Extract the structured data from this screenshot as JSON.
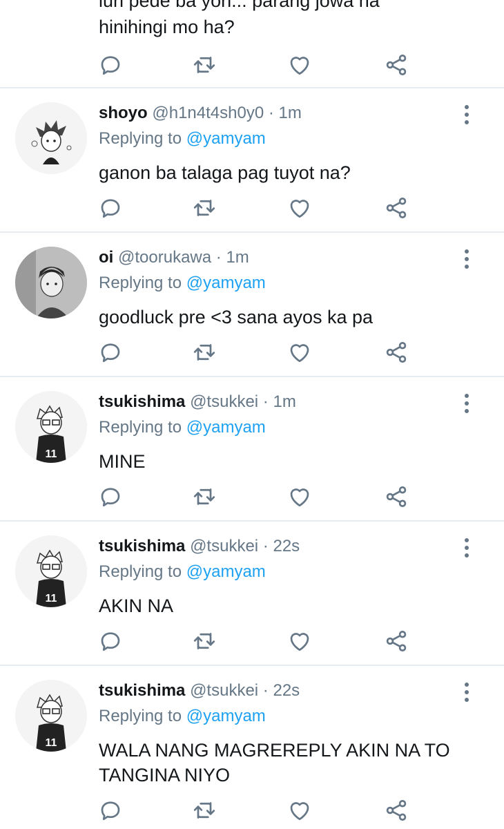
{
  "colors": {
    "text": "#14171a",
    "muted": "#657786",
    "accent": "#1da1f2",
    "divider": "#e6ecf0"
  },
  "actions": {
    "icons": [
      "reply-icon",
      "retweet-icon",
      "like-icon",
      "share-icon"
    ]
  },
  "partial_tweet": {
    "lines": [
      "iun pede ba yon... parang jowa na",
      "hinihingi mo ha?"
    ]
  },
  "tweets": [
    {
      "name": "shoyo",
      "handle": "@h1n4t4sh0y0",
      "sep": "·",
      "time": "1m",
      "reply_prefix": "Replying to",
      "reply_to": "@yamyam",
      "text": "ganon ba talaga pag tuyot na?"
    },
    {
      "name": "oi",
      "handle": "@toorukawa",
      "sep": "·",
      "time": "1m",
      "reply_prefix": "Replying to",
      "reply_to": "@yamyam",
      "text": "goodluck pre <3 sana ayos ka pa"
    },
    {
      "name": "tsukishima",
      "handle": "@tsukkei",
      "sep": "·",
      "time": "1m",
      "reply_prefix": "Replying to",
      "reply_to": "@yamyam",
      "text": "MINE"
    },
    {
      "name": "tsukishima",
      "handle": "@tsukkei",
      "sep": "·",
      "time": "22s",
      "reply_prefix": "Replying to",
      "reply_to": "@yamyam",
      "text": "AKIN NA"
    },
    {
      "name": "tsukishima",
      "handle": "@tsukkei",
      "sep": "·",
      "time": "22s",
      "reply_prefix": "Replying to",
      "reply_to": "@yamyam",
      "text": "WALA NANG MAGREREPLY AKIN NA TO TANGINA NIYO"
    }
  ]
}
